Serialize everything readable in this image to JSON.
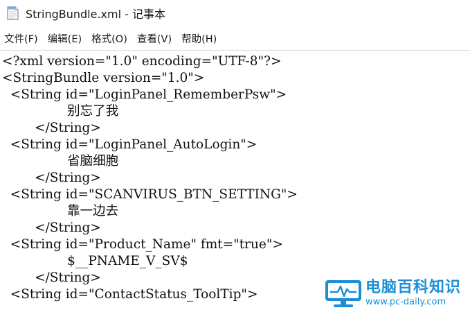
{
  "window": {
    "title": "StringBundle.xml - 记事本"
  },
  "menu": {
    "items": [
      {
        "label": "文件(F)"
      },
      {
        "label": "编辑(E)"
      },
      {
        "label": "格式(O)"
      },
      {
        "label": "查看(V)"
      },
      {
        "label": "帮助(H)"
      }
    ]
  },
  "editor": {
    "lines": [
      "<?xml version=\"1.0\" encoding=\"UTF-8\"?>",
      "<StringBundle version=\"1.0\">",
      "  <String id=\"LoginPanel_RememberPsw\">",
      "                别忘了我",
      "        </String>",
      "  <String id=\"LoginPanel_AutoLogin\">",
      "                省脑细胞",
      "        </String>",
      "  <String id=\"SCANVIRUS_BTN_SETTING\">",
      "                靠一边去",
      "        </String>",
      "  <String id=\"Product_Name\" fmt=\"true\">",
      "                $__PNAME_V_SV$",
      "        </String>",
      "  <String id=\"ContactStatus_ToolTip\">"
    ]
  },
  "watermark": {
    "title": "电脑百科知识",
    "url": "www.pc-daily.com",
    "color": "#1c8fd6"
  }
}
